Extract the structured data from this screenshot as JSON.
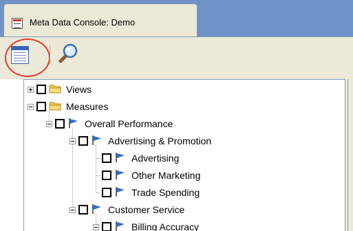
{
  "window": {
    "tab_title": "Meta Data Console: Demo"
  },
  "toolbar": {
    "buttons": [
      {
        "name": "list-view",
        "icon": "list-window-icon",
        "highlighted": true
      },
      {
        "name": "search",
        "icon": "magnifier-icon"
      }
    ]
  },
  "tree": {
    "nodes": [
      {
        "label": "Views",
        "icon": "folder-icon",
        "depth": 0,
        "expander": "plus"
      },
      {
        "label": "Measures",
        "icon": "folder-icon",
        "depth": 0,
        "expander": "minus"
      },
      {
        "label": "Overall Performance",
        "icon": "flag-icon",
        "depth": 1,
        "expander": "minus"
      },
      {
        "label": "Advertising & Promotion",
        "icon": "flag-icon",
        "depth": 2,
        "expander": "minus"
      },
      {
        "label": "Advertising",
        "icon": "flag-icon",
        "depth": 3,
        "expander": "none"
      },
      {
        "label": "Other Marketing",
        "icon": "flag-icon",
        "depth": 3,
        "expander": "none"
      },
      {
        "label": "Trade Spending",
        "icon": "flag-icon",
        "depth": 3,
        "expander": "none"
      },
      {
        "label": "Customer Service",
        "icon": "flag-icon",
        "depth": 2,
        "expander": "minus"
      },
      {
        "label": "Billing Accuracy",
        "icon": "flag-icon",
        "depth": 3,
        "expander": "minus"
      }
    ]
  },
  "colors": {
    "title_band": "#6f93c8",
    "chrome": "#ece9d8",
    "border": "#7f9db9",
    "highlight_ring": "#e53a2f",
    "folder": "#f2c94c",
    "flag": "#2a6fd6"
  }
}
